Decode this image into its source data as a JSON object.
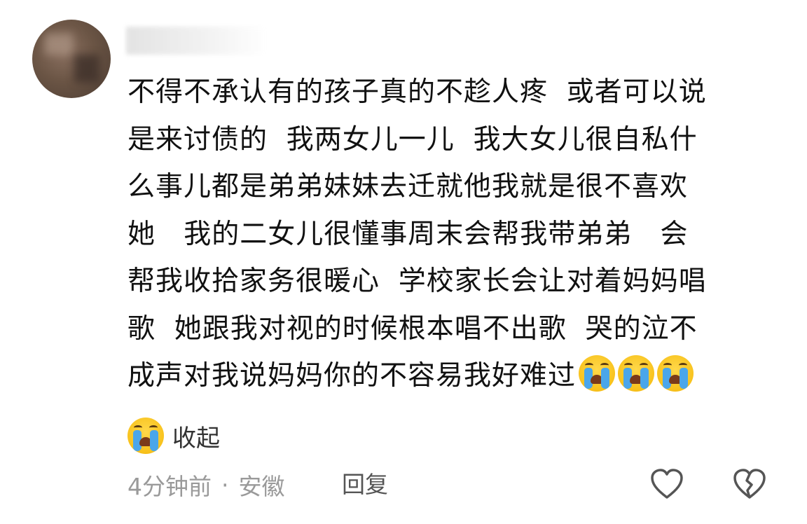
{
  "comment": {
    "lines": [
      "不得不承认有的孩子真的不趁人疼  或者可以说",
      "是来讨债的  我两女儿一儿  我大女儿很自私什",
      "么事儿都是弟弟妹妹去迁就他我就是很不喜欢",
      "她   我的二女儿很懂事周末会帮我带弟弟   会",
      "帮我收拾家务很暖心  学校家长会让对着妈妈唱",
      "歌  她跟我对视的时候根本唱不出歌  哭的泣不",
      "成声对我说妈妈你的不容易我好难过"
    ],
    "trailing_emoji": [
      "loudly-crying-face",
      "loudly-crying-face",
      "loudly-crying-face"
    ]
  },
  "collapse": {
    "icon": "loudly-crying-face",
    "label": "收起"
  },
  "meta": {
    "time": "4分钟前",
    "separator": "·",
    "location": "安徽",
    "reply_label": "回复"
  },
  "actions": {
    "like_icon": "heart-outline-icon",
    "dislike_icon": "broken-heart-outline-icon"
  }
}
